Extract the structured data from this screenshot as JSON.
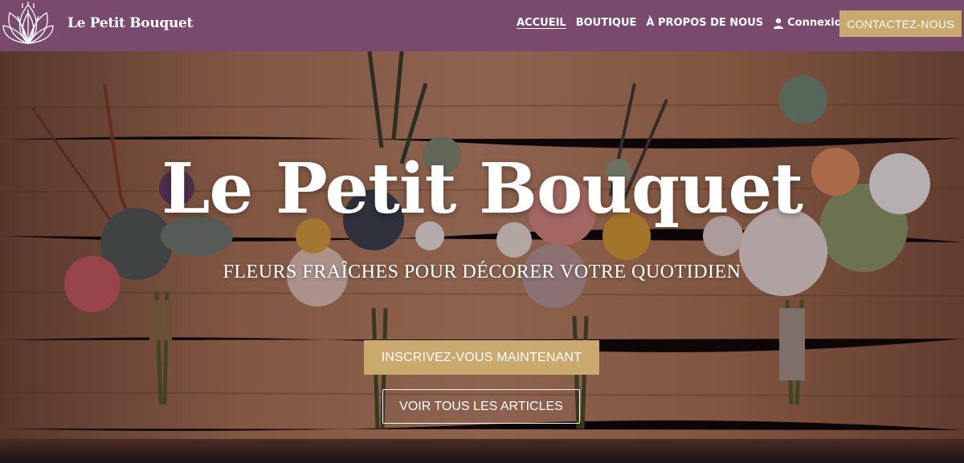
{
  "header": {
    "brand": "Le Petit Bouquet",
    "nav": {
      "home": "ACCUEIL",
      "shop": "BOUTIQUE",
      "about": "À PROPOS DE NOUS",
      "login": "Connexion"
    },
    "contact_button": "CONTACTEZ-NOUS"
  },
  "hero": {
    "title": "Le Petit Bouquet",
    "subtitle": "FLEURS FRAÎCHES POUR DÉCORER VOTRE QUOTIDIEN",
    "primary_button": "INSCRIVEZ-VOUS MAINTENANT",
    "secondary_button": "VOIR TOUS LES ARTICLES"
  },
  "colors": {
    "navbar": "#7a4a6e",
    "accent_gold": "#c9a96e",
    "text": "#ffffff"
  },
  "icons": {
    "logo": "lotus-flower-logo",
    "login": "user-icon"
  }
}
